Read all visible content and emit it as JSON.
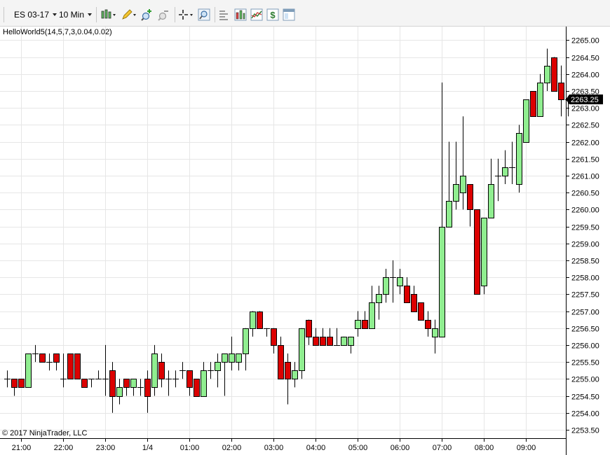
{
  "toolbar": {
    "instrument": "ES 03-17",
    "interval": "10 Min",
    "icons": [
      "bars-type-icon",
      "pencil-draw-icon",
      "zoom-in-icon",
      "zoom-out-icon",
      "crosshair-icon",
      "magnifier-icon",
      "data-box-icon",
      "chart-properties-icon",
      "indicators-icon",
      "strategies-icon",
      "templates-icon"
    ]
  },
  "indicator_label": "HelloWorld5(14,5,7,3,0.04,0.02)",
  "copyright": "© 2017 NinjaTrader, LLC",
  "colors": {
    "up_candle": "#90ee90",
    "down_candle": "#dc0000",
    "wick": "#000000",
    "grid": "#e6e6e6",
    "last_price_bg": "#000000",
    "last_price_fg": "#ffffff"
  },
  "chart_data": {
    "type": "candlestick",
    "time_labels": [
      "21:00",
      "22:00",
      "23:00",
      "1/4",
      "01:00",
      "02:00",
      "03:00",
      "04:00",
      "05:00",
      "06:00",
      "07:00",
      "08:00",
      "09:00"
    ],
    "time_label_bar_index": [
      2,
      8,
      14,
      20,
      26,
      32,
      38,
      44,
      50,
      56,
      62,
      68,
      74
    ],
    "y_ticks": [
      "2265.00",
      "2264.50",
      "2264.00",
      "2263.50",
      "2263.00",
      "2262.50",
      "2262.00",
      "2261.50",
      "2261.00",
      "2260.50",
      "2260.00",
      "2259.50",
      "2259.00",
      "2258.50",
      "2258.00",
      "2257.50",
      "2257.00",
      "2256.50",
      "2256.00",
      "2255.50",
      "2255.00",
      "2254.50",
      "2254.00",
      "2253.50"
    ],
    "ylim": [
      2253.25,
      2265.4
    ],
    "grid": true,
    "last_price": "2263.25",
    "last_price_value": 2263.25,
    "bars": [
      [
        2255.0,
        2255.25,
        2254.75,
        2255.0
      ],
      [
        2255.0,
        2255.0,
        2254.5,
        2254.75
      ],
      [
        2255.0,
        2255.0,
        2254.75,
        2254.75
      ],
      [
        2254.75,
        2255.75,
        2254.75,
        2255.75
      ],
      [
        2255.75,
        2256.0,
        2255.5,
        2255.75
      ],
      [
        2255.75,
        2255.75,
        2255.5,
        2255.5
      ],
      [
        2255.5,
        2255.75,
        2255.25,
        2255.5
      ],
      [
        2255.75,
        2255.75,
        2255.25,
        2255.5
      ],
      [
        2255.0,
        2255.75,
        2254.75,
        2255.0
      ],
      [
        2255.75,
        2255.75,
        2255.0,
        2255.0
      ],
      [
        2255.75,
        2255.75,
        2255.0,
        2255.0
      ],
      [
        2255.0,
        2255.0,
        2254.75,
        2254.75
      ],
      [
        2255.0,
        2255.0,
        2254.75,
        2255.0
      ],
      [
        2255.0,
        2255.25,
        2255.0,
        2255.0
      ],
      [
        2255.0,
        2256.0,
        2254.5,
        2255.0
      ],
      [
        2255.25,
        2255.5,
        2254.0,
        2254.5
      ],
      [
        2254.5,
        2255.0,
        2254.25,
        2254.75
      ],
      [
        2255.0,
        2255.0,
        2254.5,
        2254.75
      ],
      [
        2254.75,
        2255.0,
        2254.5,
        2255.0
      ],
      [
        2254.75,
        2255.0,
        2254.5,
        2254.75
      ],
      [
        2255.0,
        2255.25,
        2254.0,
        2254.5
      ],
      [
        2254.75,
        2256.0,
        2254.5,
        2255.75
      ],
      [
        2255.5,
        2255.75,
        2254.75,
        2255.0
      ],
      [
        2255.0,
        2255.25,
        2254.5,
        2255.0
      ],
      [
        2255.0,
        2255.25,
        2254.75,
        2255.0
      ],
      [
        2255.25,
        2255.5,
        2255.0,
        2255.25
      ],
      [
        2255.25,
        2255.25,
        2254.5,
        2254.75
      ],
      [
        2255.0,
        2255.0,
        2254.5,
        2254.5
      ],
      [
        2254.5,
        2255.5,
        2254.5,
        2255.25
      ],
      [
        2255.25,
        2255.5,
        2255.0,
        2255.25
      ],
      [
        2255.25,
        2255.75,
        2254.75,
        2255.5
      ],
      [
        2255.5,
        2255.75,
        2254.5,
        2255.75
      ],
      [
        2255.5,
        2256.25,
        2255.25,
        2255.75
      ],
      [
        2255.5,
        2255.75,
        2255.25,
        2255.75
      ],
      [
        2255.75,
        2256.5,
        2255.25,
        2256.5
      ],
      [
        2256.5,
        2257.0,
        2256.25,
        2257.0
      ],
      [
        2257.0,
        2257.0,
        2256.5,
        2256.5
      ],
      [
        2256.5,
        2256.5,
        2256.25,
        2256.5
      ],
      [
        2256.5,
        2256.5,
        2255.75,
        2256.0
      ],
      [
        2256.0,
        2256.25,
        2255.0,
        2255.0
      ],
      [
        2255.5,
        2255.75,
        2254.25,
        2255.0
      ],
      [
        2255.0,
        2255.5,
        2254.75,
        2255.25
      ],
      [
        2255.25,
        2256.5,
        2255.0,
        2256.5
      ],
      [
        2256.75,
        2256.75,
        2256.0,
        2256.25
      ],
      [
        2256.25,
        2256.5,
        2256.0,
        2256.0
      ],
      [
        2256.25,
        2256.5,
        2256.0,
        2256.0
      ],
      [
        2256.25,
        2256.5,
        2256.0,
        2256.0
      ],
      [
        2256.0,
        2256.5,
        2256.0,
        2256.0
      ],
      [
        2256.0,
        2256.25,
        2256.0,
        2256.25
      ],
      [
        2256.0,
        2256.25,
        2255.75,
        2256.25
      ],
      [
        2256.5,
        2257.0,
        2256.25,
        2256.75
      ],
      [
        2256.75,
        2257.0,
        2256.5,
        2256.5
      ],
      [
        2256.5,
        2257.75,
        2256.5,
        2257.25
      ],
      [
        2257.25,
        2257.75,
        2256.75,
        2257.5
      ],
      [
        2257.5,
        2258.25,
        2257.25,
        2258.0
      ],
      [
        2258.0,
        2258.5,
        2257.25,
        2258.0
      ],
      [
        2257.75,
        2258.25,
        2257.5,
        2258.0
      ],
      [
        2257.75,
        2258.0,
        2257.25,
        2257.25
      ],
      [
        2257.5,
        2257.75,
        2257.0,
        2257.0
      ],
      [
        2257.25,
        2257.25,
        2256.75,
        2256.75
      ],
      [
        2256.75,
        2257.0,
        2256.25,
        2256.5
      ],
      [
        2256.25,
        2256.75,
        2255.75,
        2256.5
      ],
      [
        2256.25,
        2263.75,
        2256.25,
        2259.5
      ],
      [
        2259.5,
        2262.0,
        2259.5,
        2260.25
      ],
      [
        2260.25,
        2262.0,
        2260.0,
        2260.75
      ],
      [
        2260.5,
        2262.75,
        2260.0,
        2261.0
      ],
      [
        2260.75,
        2260.75,
        2259.5,
        2260.0
      ],
      [
        2260.0,
        2260.0,
        2257.5,
        2257.5
      ],
      [
        2257.75,
        2259.75,
        2257.5,
        2259.75
      ],
      [
        2259.75,
        2261.5,
        2259.75,
        2260.75
      ],
      [
        2261.0,
        2261.5,
        2260.25,
        2261.0
      ],
      [
        2261.0,
        2261.75,
        2260.75,
        2261.25
      ],
      [
        2261.25,
        2262.0,
        2260.75,
        2261.25
      ],
      [
        2260.75,
        2262.5,
        2260.5,
        2262.25
      ],
      [
        2262.0,
        2263.0,
        2262.0,
        2263.25
      ],
      [
        2263.5,
        2263.5,
        2262.75,
        2262.75
      ],
      [
        2262.75,
        2264.0,
        2262.75,
        2263.75
      ],
      [
        2263.75,
        2264.75,
        2263.5,
        2264.25
      ],
      [
        2264.5,
        2264.5,
        2263.5,
        2263.5
      ],
      [
        2263.75,
        2264.25,
        2262.75,
        2263.25
      ],
      [
        2263.25,
        2263.25,
        2262.75,
        2263.25
      ]
    ]
  }
}
